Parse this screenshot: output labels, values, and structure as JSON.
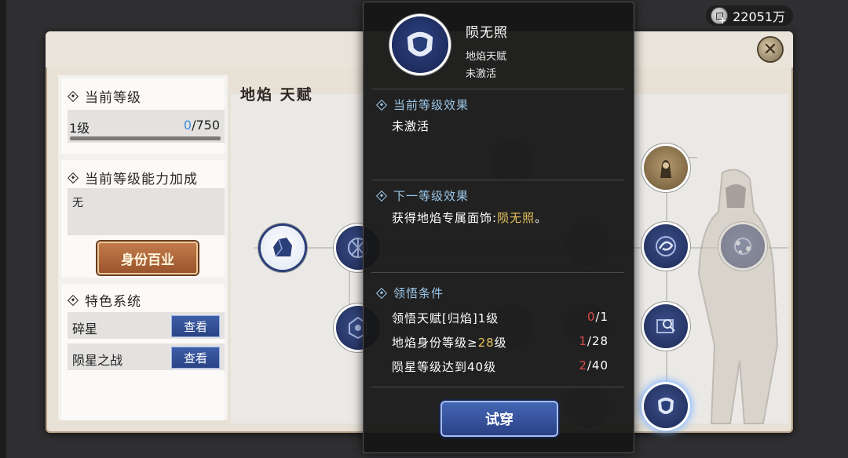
{
  "currency": {
    "amount": "22051万",
    "icon": "silver-coin-icon"
  },
  "sidebar": {
    "level_card": {
      "title": "当前等级",
      "level": "1级",
      "progress_current": "0",
      "progress_max": "/750",
      "progress_fraction": 0
    },
    "bonus_card": {
      "title": "当前等级能力加成",
      "value": "无"
    },
    "baiye_button": "身份百业",
    "systems": {
      "title": "特色系统",
      "items": [
        {
          "label": "碎星",
          "button": "查看"
        },
        {
          "label": "陨星之战",
          "button": "查看"
        }
      ]
    }
  },
  "main": {
    "title": "地焰 天赋"
  },
  "popup": {
    "name": "陨无照",
    "type": "地焰天赋",
    "status": "未激活",
    "current_effect": {
      "title": "当前等级效果",
      "text": "未激活"
    },
    "next_effect": {
      "title": "下一等级效果",
      "text_prefix": "获得地焰专属面饰:",
      "highlight": "陨无照",
      "text_suffix": "。"
    },
    "conditions": {
      "title": "领悟条件",
      "rows": [
        {
          "label": "领悟天赋[归焰]1级",
          "current": "0",
          "max": "/1"
        },
        {
          "label_prefix": "地焰身份等级≥",
          "label_highlight": "28",
          "label_suffix": "级",
          "current": "1",
          "max": "/28"
        },
        {
          "label": "陨星等级达到40级",
          "current": "2",
          "max": "/40"
        }
      ]
    },
    "try_button": "试穿"
  },
  "colors": {
    "accent_blue": "#3b8ee0",
    "gold": "#e7c45d",
    "red": "#e04b4b"
  }
}
